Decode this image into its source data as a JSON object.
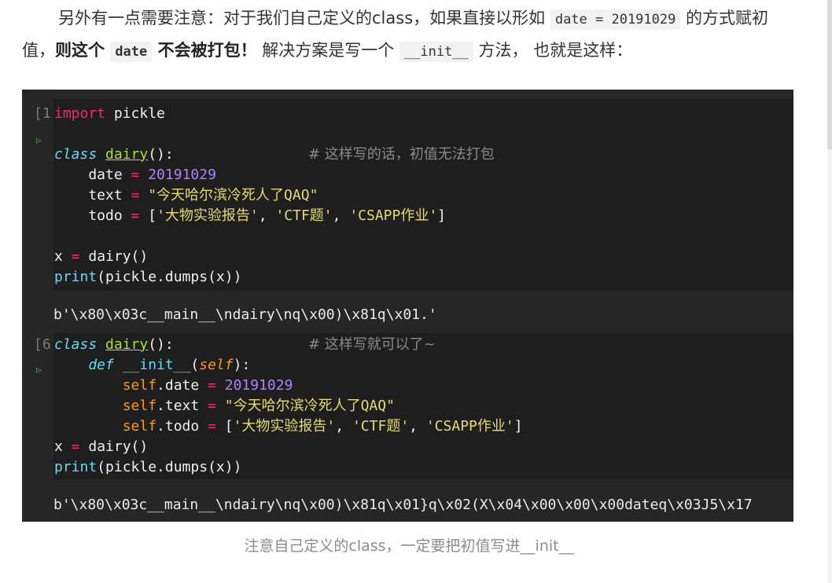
{
  "paragraph": {
    "part1": "另外有一点需要注意：对于我们自己定义的class，如果直接以形如",
    "code1": "date = 20191029",
    "part2": "的方式赋初值，",
    "bold1": "则这个",
    "code2": "date",
    "bold2": "不会被打包！",
    "part3": "解决方案是写一个",
    "code3": "__init__",
    "part4": "方法，  也就是这样："
  },
  "notebook": {
    "cell1": {
      "prompt": "[1",
      "run_icon": "play-triangle-icon",
      "l1_kw": "import",
      "l1_rest": " pickle",
      "l2_kw": "class",
      "l2_name": "dairy",
      "l2_rest": "():",
      "l2_comment": "# 这样写的话，初值无法打包",
      "l3_name": "    date",
      "l3_op": " = ",
      "l3_val": "20191029",
      "l4_name": "    text",
      "l4_op": " = ",
      "l4_val": "\"今天哈尔滨冷死人了QAQ\"",
      "l5_name": "    todo",
      "l5_op": " = ",
      "l5_open": "[",
      "l5_s1": "'大物实验报告'",
      "l5_c1": ", ",
      "l5_s2": "'CTF题'",
      "l5_c2": ", ",
      "l5_s3": "'CSAPP作业'",
      "l5_close": "]",
      "l6_name": "x",
      "l6_op": " = ",
      "l6_rest": "dairy()",
      "l7_fn": "print",
      "l7_rest": "(pickle.dumps(x))",
      "output": "b'\\x80\\x03c__main__\\ndairy\\nq\\x00)\\x81q\\x01.'"
    },
    "cell2": {
      "prompt": "[6",
      "run_icon": "play-triangle-icon",
      "l1_kw": "class",
      "l1_name": "dairy",
      "l1_rest": "():",
      "l1_comment": "# 这样写就可以了~",
      "l2_def": "    def",
      "l2_name": " __init__",
      "l2_open": "(",
      "l2_self": "self",
      "l2_close": "):",
      "l3_self": "        self",
      "l3_attr": ".date",
      "l3_op": " = ",
      "l3_val": "20191029",
      "l4_self": "        self",
      "l4_attr": ".text",
      "l4_op": " = ",
      "l4_val": "\"今天哈尔滨冷死人了QAQ\"",
      "l5_self": "        self",
      "l5_attr": ".todo",
      "l5_op": " = ",
      "l5_open": "[",
      "l5_s1": "'大物实验报告'",
      "l5_c1": ", ",
      "l5_s2": "'CTF题'",
      "l5_c2": ", ",
      "l5_s3": "'CSAPP作业'",
      "l5_close": "]",
      "l6_name": "x",
      "l6_op": " = ",
      "l6_rest": "dairy()",
      "l7_fn": "print",
      "l7_rest": "(pickle.dumps(x))",
      "output": "b'\\x80\\x03c__main__\\ndairy\\nq\\x00)\\x81q\\x01}q\\x02(X\\x04\\x00\\x00\\x00dateq\\x03J5\\x17"
    }
  },
  "caption": "注意自己定义的class，一定要把初值写进__init__"
}
